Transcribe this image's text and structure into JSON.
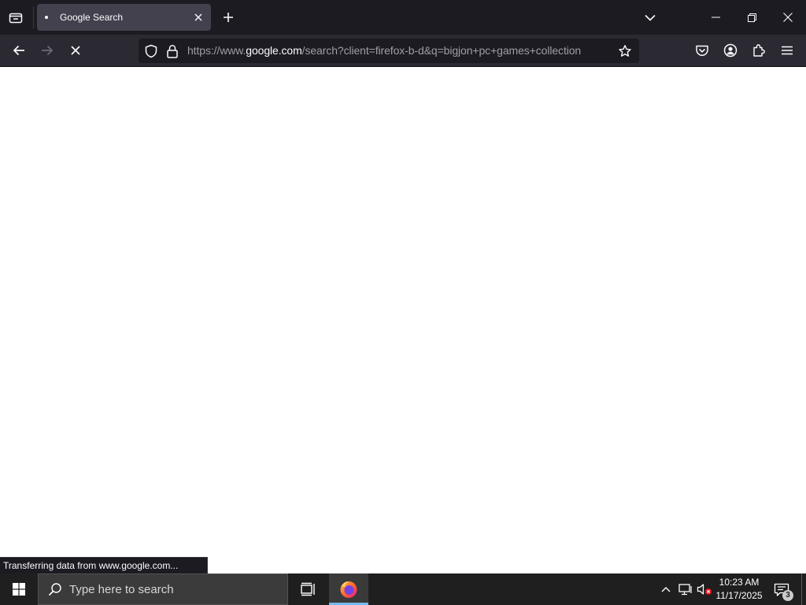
{
  "browser": {
    "tab": {
      "title": "Google Search"
    },
    "urlbar": {
      "scheme": "https://www.",
      "host": "google.com",
      "rest": "/search?client=firefox-b-d&q=bigjon+pc+games+collection"
    },
    "status_text": "Transferring data from www.google.com...",
    "icons": [
      "tab-list-icon",
      "close-icon",
      "plus-icon",
      "chevron-down-icon",
      "minimize-icon",
      "restore-icon",
      "back-arrow-icon",
      "forward-arrow-icon",
      "stop-icon",
      "shield-icon",
      "lock-icon",
      "star-icon",
      "pocket-icon",
      "account-icon",
      "extensions-icon",
      "hamburger-menu-icon"
    ],
    "colors": {
      "tabbar": "#1c1b22",
      "toolbar": "#2b2a33",
      "active_tab": "#42414d",
      "urlbar": "#1c1b22"
    }
  },
  "taskbar": {
    "search_placeholder": "Type here to search",
    "clock": {
      "time": "10:23 AM",
      "date": "11/17/2025"
    },
    "notification_count": "3",
    "icons": [
      "windows-start-icon",
      "search-icon",
      "task-view-icon",
      "firefox-icon",
      "chevron-up-icon",
      "network-icon",
      "volume-muted-icon",
      "notification-icon"
    ],
    "colors": {
      "background": "#1f1f1f",
      "search_box": "#3b3b3b",
      "active_indicator": "#76b9ed"
    }
  }
}
